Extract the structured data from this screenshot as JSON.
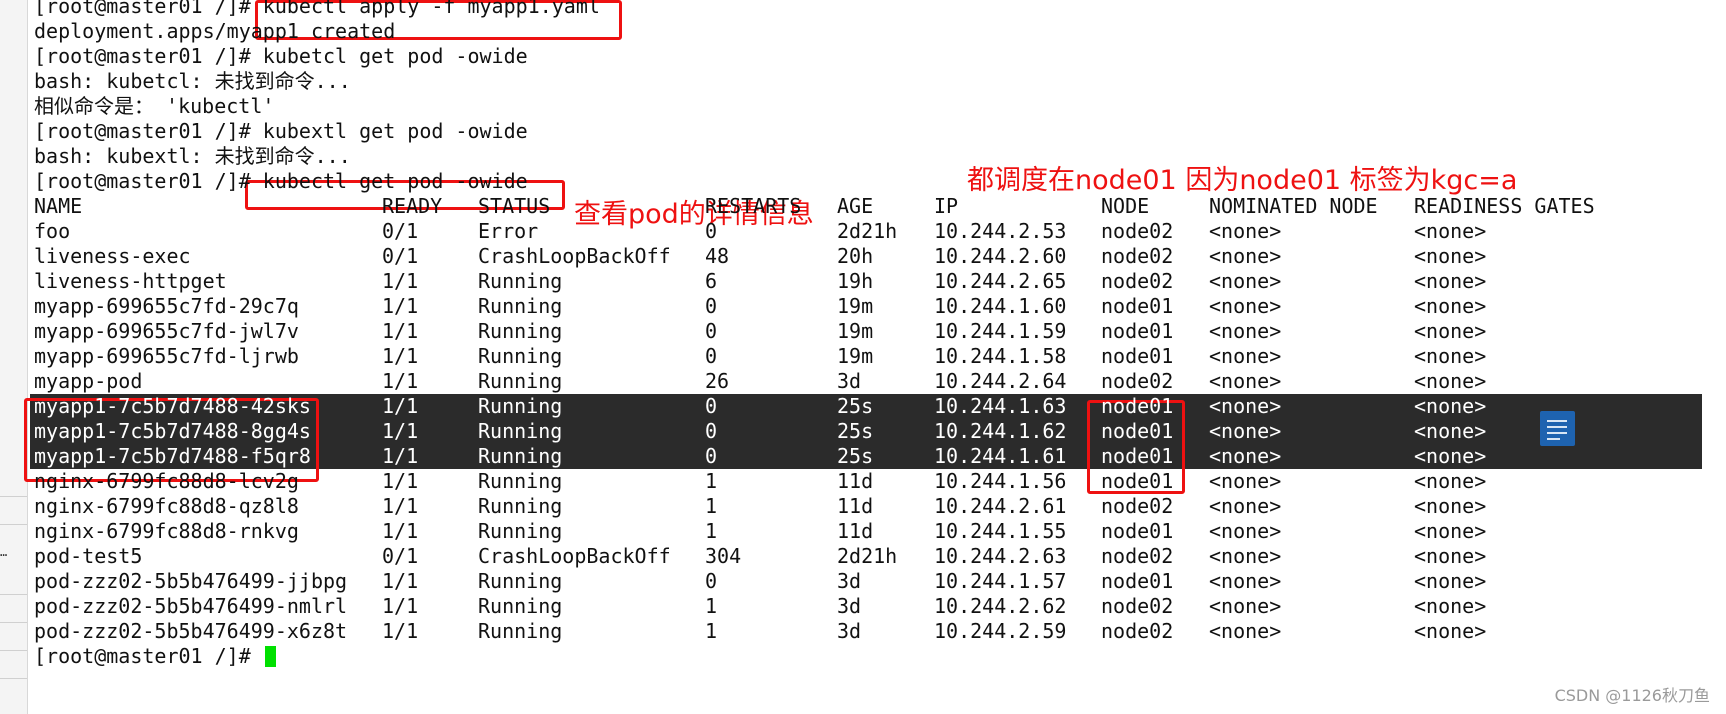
{
  "terminal": {
    "cmd_lines": [
      "[root@master01 /]# kubectl apply -f myapp1.yaml",
      "deployment.apps/myapp1 created",
      "[root@master01 /]# kubetcl get pod -owide",
      "bash: kubetcl: 未找到命令...",
      "相似命令是： 'kubectl'",
      "[root@master01 /]# kubextl get pod -owide",
      "bash: kubextl: 未找到命令...",
      "[root@master01 /]# kubectl get pod -owide"
    ],
    "headers": [
      "NAME",
      "READY",
      "STATUS",
      "RESTARTS",
      "AGE",
      "IP",
      "NODE",
      "NOMINATED NODE",
      "READINESS GATES"
    ],
    "rows": [
      [
        "foo",
        "0/1",
        "Error",
        "0",
        "2d21h",
        "10.244.2.53",
        "node02",
        "<none>",
        "<none>"
      ],
      [
        "liveness-exec",
        "0/1",
        "CrashLoopBackOff",
        "48",
        "20h",
        "10.244.2.60",
        "node02",
        "<none>",
        "<none>"
      ],
      [
        "liveness-httpget",
        "1/1",
        "Running",
        "6",
        "19h",
        "10.244.2.65",
        "node02",
        "<none>",
        "<none>"
      ],
      [
        "myapp-699655c7fd-29c7q",
        "1/1",
        "Running",
        "0",
        "19m",
        "10.244.1.60",
        "node01",
        "<none>",
        "<none>"
      ],
      [
        "myapp-699655c7fd-jwl7v",
        "1/1",
        "Running",
        "0",
        "19m",
        "10.244.1.59",
        "node01",
        "<none>",
        "<none>"
      ],
      [
        "myapp-699655c7fd-ljrwb",
        "1/1",
        "Running",
        "0",
        "19m",
        "10.244.1.58",
        "node01",
        "<none>",
        "<none>"
      ],
      [
        "myapp-pod",
        "1/1",
        "Running",
        "26",
        "3d",
        "10.244.2.64",
        "node02",
        "<none>",
        "<none>"
      ],
      [
        "myapp1-7c5b7d7488-42sks",
        "1/1",
        "Running",
        "0",
        "25s",
        "10.244.1.63",
        "node01",
        "<none>",
        "<none>"
      ],
      [
        "myapp1-7c5b7d7488-8gg4s",
        "1/1",
        "Running",
        "0",
        "25s",
        "10.244.1.62",
        "node01",
        "<none>",
        "<none>"
      ],
      [
        "myapp1-7c5b7d7488-f5qr8",
        "1/1",
        "Running",
        "0",
        "25s",
        "10.244.1.61",
        "node01",
        "<none>",
        "<none>"
      ],
      [
        "nginx-6799fc88d8-lcv2g",
        "1/1",
        "Running",
        "1",
        "11d",
        "10.244.1.56",
        "node01",
        "<none>",
        "<none>"
      ],
      [
        "nginx-6799fc88d8-qz8l8",
        "1/1",
        "Running",
        "1",
        "11d",
        "10.244.2.61",
        "node02",
        "<none>",
        "<none>"
      ],
      [
        "nginx-6799fc88d8-rnkvg",
        "1/1",
        "Running",
        "1",
        "11d",
        "10.244.1.55",
        "node01",
        "<none>",
        "<none>"
      ],
      [
        "pod-test5",
        "0/1",
        "CrashLoopBackOff",
        "304",
        "2d21h",
        "10.244.2.63",
        "node02",
        "<none>",
        "<none>"
      ],
      [
        "pod-zzz02-5b5b476499-jjbpg",
        "1/1",
        "Running",
        "0",
        "3d",
        "10.244.1.57",
        "node01",
        "<none>",
        "<none>"
      ],
      [
        "pod-zzz02-5b5b476499-nmlrl",
        "1/1",
        "Running",
        "1",
        "3d",
        "10.244.2.62",
        "node02",
        "<none>",
        "<none>"
      ],
      [
        "pod-zzz02-5b5b476499-x6z8t",
        "1/1",
        "Running",
        "1",
        "3d",
        "10.244.2.59",
        "node02",
        "<none>",
        "<none>"
      ]
    ],
    "prompt": "[root@master01 /]# ",
    "selected_rows": [
      7,
      8,
      9
    ]
  },
  "annotations": {
    "view_pod_details": "查看pod的详情信息",
    "scheduling_note": "都调度在node01  因为node01 标签为kgc=a"
  },
  "watermark": "CSDN @1126秋刀鱼",
  "gutter_dots": "…",
  "icon": "document-icon",
  "colors": {
    "annotation_red": "#ee1111",
    "selection_bg": "#2b2b2b",
    "cursor": "#00e000",
    "icon_blue": "#1e63b0"
  }
}
